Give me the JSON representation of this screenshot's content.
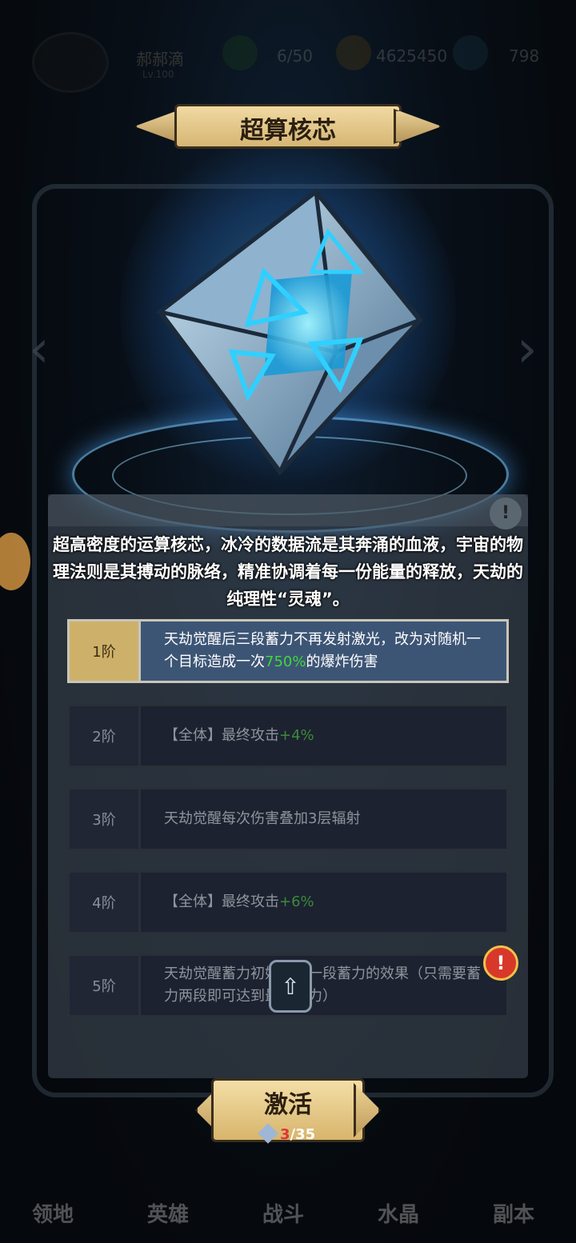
{
  "top": {
    "player_name": "郝郝滴",
    "level": "Lv.100",
    "stamina": "6/50",
    "gold": "4625450",
    "gems": "798"
  },
  "banner": {
    "title": "超算核芯"
  },
  "description": "超高密度的运算核芯，冰冷的数据流是其奔涌的血液，宇宙的物理法则是其搏动的脉络，精准协调着每一份能量的释放，天劫的纯理性“灵魂”。",
  "tiers": [
    {
      "label": "1阶",
      "text_pre": "天劫觉醒后三段蓄力不再发射激光，改为对随机一个目标造成一次",
      "highlight": "750%",
      "text_post": "的爆炸伤害"
    },
    {
      "label": "2阶",
      "text_pre": "【全体】最终攻击",
      "highlight": "+4%",
      "text_post": ""
    },
    {
      "label": "3阶",
      "text_pre": "天劫觉醒每次伤害叠加3层辐射",
      "highlight": "",
      "text_post": ""
    },
    {
      "label": "4阶",
      "text_pre": "【全体】最终攻击",
      "highlight": "+6%",
      "text_post": ""
    },
    {
      "label": "5阶",
      "text_pre": "天劫觉醒蓄力初始获得一段蓄力的效果（只需要蓄力两段即可达到最大蓄力）",
      "highlight": "",
      "text_post": ""
    }
  ],
  "alert_mark": "!",
  "activate": {
    "label": "激活",
    "current": "3",
    "total": "/35"
  },
  "nav": [
    "领地",
    "英雄",
    "战斗",
    "水晶",
    "副本"
  ],
  "colors": {
    "accent_gold": "#cdb06a",
    "highlight_green": "#3fd83a",
    "cost_red": "#e33434"
  }
}
